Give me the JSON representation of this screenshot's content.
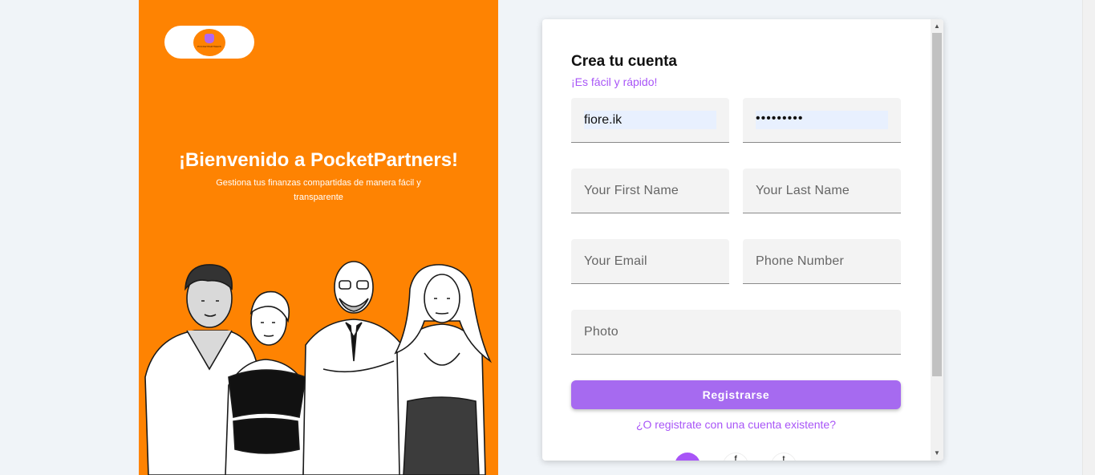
{
  "hero": {
    "brand_small": "POCKETPARTNERS",
    "title": "¡Bienvenido a PocketPartners!",
    "subtitle": "Gestiona tus finanzas compartidas de manera fácil y transparente"
  },
  "form": {
    "title": "Crea tu cuenta",
    "subtitle": "¡Es fácil y rápido!",
    "username_value": "fiore.ik",
    "password_value": "•••••••••",
    "first_name_placeholder": "Your First Name",
    "last_name_placeholder": "Your Last Name",
    "email_placeholder": "Your Email",
    "phone_placeholder": "Phone Number",
    "photo_placeholder": "Photo",
    "submit_label": "Registrarse",
    "login_link": "¿O registrate con una cuenta existente?",
    "social_icons": [
      "google-icon",
      "facebook-icon",
      "twitter-icon"
    ]
  },
  "colors": {
    "hero_orange": "#fe8302",
    "accent_purple": "#a66af0",
    "link_purple": "#a855f7"
  }
}
